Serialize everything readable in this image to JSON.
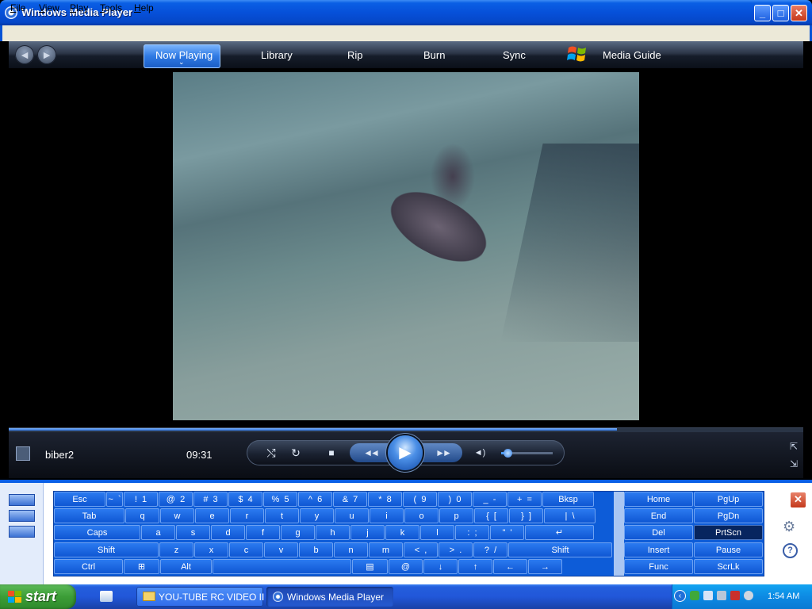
{
  "window": {
    "title": "Windows Media Player",
    "controls": {
      "minimize": "_",
      "maximize": "□",
      "close": "✕"
    }
  },
  "menu": [
    "File",
    "View",
    "Play",
    "Tools",
    "Help"
  ],
  "nav": {
    "back": "◄",
    "forward": "►",
    "tabs": [
      "Now Playing",
      "Library",
      "Rip",
      "Burn",
      "Sync",
      "Media Guide"
    ],
    "active_indicator": "⌄"
  },
  "now_playing": {
    "track": "biber2",
    "time": "09:31",
    "seek_progress_fraction": 0.765,
    "volume_fraction": 0.12
  },
  "transport": {
    "shuffle": "⤭",
    "repeat": "↻",
    "stop": "■",
    "prev": "◄◄",
    "play": "▶",
    "next": "►►",
    "mute": "◄)"
  },
  "corner_icons": {
    "fullscreen": "⇱",
    "compact": "⇲"
  },
  "keyboard": {
    "rows": [
      [
        "Esc",
        "~  `",
        "!  1",
        "@  2",
        "#  3",
        "$  4",
        "%  5",
        "^  6",
        "&  7",
        "*  8",
        "(  9",
        ")  0",
        "_  -",
        "+  =",
        "Bksp"
      ],
      [
        "Tab",
        "q",
        "w",
        "e",
        "r",
        "t",
        "y",
        "u",
        "i",
        "o",
        "p",
        "{  [",
        "}  ]",
        "|  \\"
      ],
      [
        "Caps",
        "a",
        "s",
        "d",
        "f",
        "g",
        "h",
        "j",
        "k",
        "l",
        ":  ;",
        "\"  '",
        "↵"
      ],
      [
        "Shift",
        "z",
        "x",
        "c",
        "v",
        "b",
        "n",
        "m",
        "<  ,",
        ">  .",
        "?  /",
        "Shift"
      ],
      [
        "Ctrl",
        "⊞",
        "Alt",
        "",
        "▤",
        "@",
        "↓",
        "↑",
        "←",
        "→"
      ]
    ],
    "nav_keys": [
      [
        "Home",
        "PgUp"
      ],
      [
        "End",
        "PgDn"
      ],
      [
        "Del",
        "PrtScn"
      ],
      [
        "Insert",
        "Pause"
      ],
      [
        "Func",
        "ScrLk"
      ]
    ],
    "highlighted_key": "PrtScn",
    "close": "✕",
    "settings": "⚙",
    "help": "?"
  },
  "taskbar": {
    "start": "start",
    "tasks": [
      {
        "label": "YOU-TUBE RC VIDEO II",
        "icon": "folder-icon",
        "active": false
      },
      {
        "label": "Windows Media Player",
        "icon": "media-player-icon",
        "active": true
      }
    ],
    "clock": "1:54 AM"
  },
  "colors": {
    "title_bar": "#0650d9",
    "accent_blue": "#2f7ae3",
    "start_green": "#3c9d37",
    "key_blue": "#0f57d3",
    "key_dark": "#07255f"
  }
}
